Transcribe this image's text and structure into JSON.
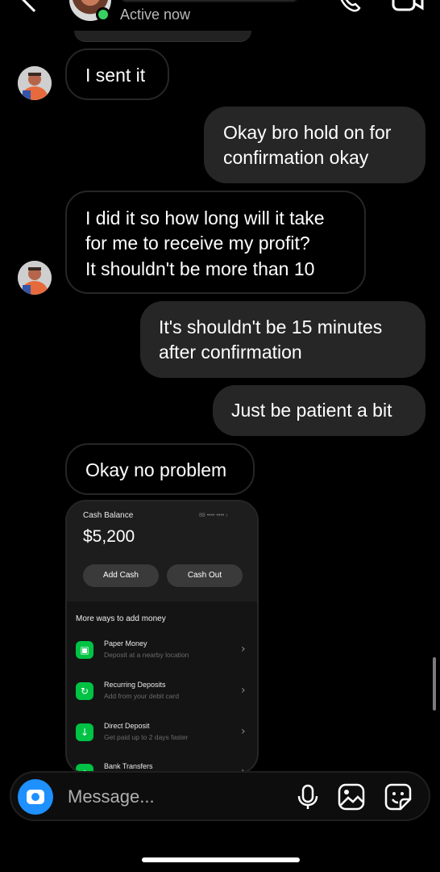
{
  "header": {
    "status": "Active now"
  },
  "messages": [
    {
      "side": "in",
      "text": "I sent it"
    },
    {
      "side": "out",
      "lines": [
        "Okay bro hold on for",
        "confirmation okay"
      ]
    },
    {
      "side": "in",
      "lines": [
        "I did it so how long will it take",
        "for me to receive my profit?",
        "It shouldn't be more than 10"
      ]
    },
    {
      "side": "out",
      "lines": [
        "It's shouldn't be 15 minutes",
        "after confirmation"
      ]
    },
    {
      "side": "out",
      "text": "Just be patient a bit"
    },
    {
      "side": "in",
      "text": "Okay no problem"
    }
  ],
  "cash_screenshot": {
    "balance_label": "Cash Balance",
    "account_mask": "88 •••• ••••  ›",
    "amount": "$5,200",
    "add_cash": "Add Cash",
    "cash_out": "Cash Out",
    "more_ways": "More ways to add money",
    "rows": [
      {
        "title": "Paper Money",
        "subtitle": "Deposit at a nearby location",
        "icon": "cash-bill-icon"
      },
      {
        "title": "Recurring Deposits",
        "subtitle": "Add from your debit card",
        "icon": "recurring-icon"
      },
      {
        "title": "Direct Deposit",
        "subtitle": "Get paid up to 2 days faster",
        "icon": "download-icon"
      },
      {
        "title": "Bank Transfers",
        "subtitle": "",
        "icon": "bank-icon"
      }
    ]
  },
  "composer": {
    "placeholder": "Message...",
    "icons": [
      "camera-icon",
      "microphone-icon",
      "gallery-icon",
      "sticker-icon"
    ]
  },
  "colors": {
    "incoming_border": "#262626",
    "outgoing_bg": "#262626",
    "camera_button": "#1e90ff",
    "online": "#37d160",
    "cash_green": "#00c244"
  }
}
